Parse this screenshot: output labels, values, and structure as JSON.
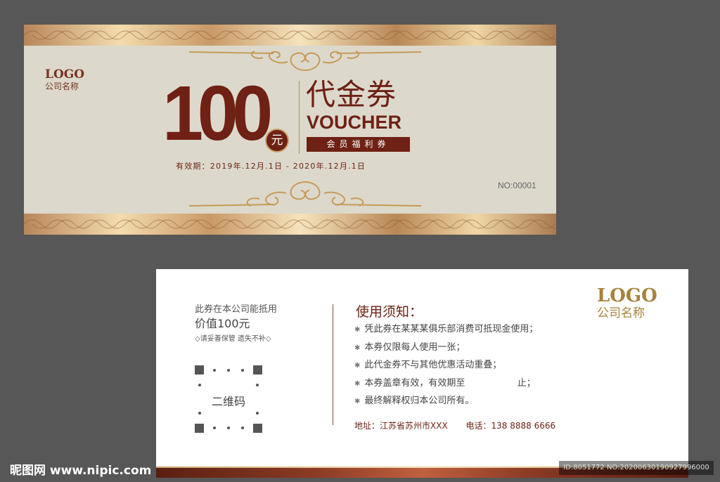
{
  "front": {
    "logo": "LOGO",
    "company": "公司名称",
    "amount": "100",
    "currency": "元",
    "title_cn": "代金券",
    "title_en": "VOUCHER",
    "member_label": "会员福利券",
    "validity": "有效期：2019年.12月.1日 - 2020年.12月.1日",
    "serial": "NO:00001"
  },
  "back": {
    "worth_line1": "此券在本公司能抵用",
    "worth_line2": "价值100元",
    "keep_note": "◇请妥善保管 遗失不补◇",
    "qr_label": "二维码",
    "notice_title": "使用须知：",
    "notice_items": [
      "凭此券在某某某俱乐部消费可抵现金使用；",
      "本券仅限每人使用一张；",
      "此代金券不与其他优惠活动重叠；",
      "本券盖章有效，有效期至                  止；",
      "最终解释权归本公司所有。"
    ],
    "address": "地址：江苏省苏州市XXX",
    "phone": "电话：138 8888 6666",
    "logo": "LOGO",
    "company": "公司名称"
  },
  "watermark": {
    "site": "昵图网 www.nipic.com",
    "id": "ID:8051772 NO:20200630190927996000"
  },
  "colors": {
    "brand_maroon": "#6e2114",
    "gold": "#c9a36a",
    "front_bg": "#dcd9cc",
    "page_bg": "#575757"
  }
}
